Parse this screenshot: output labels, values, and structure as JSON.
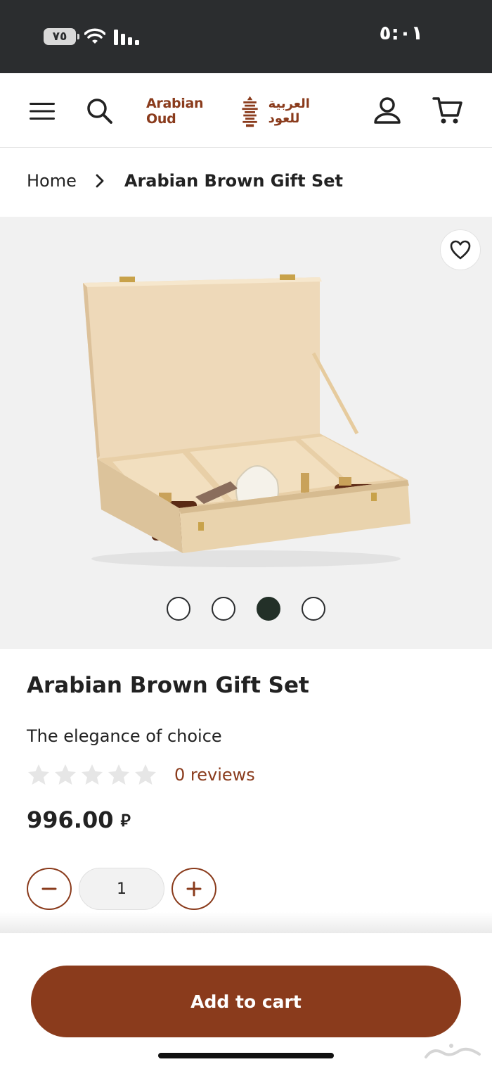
{
  "status_bar": {
    "battery": "٧٥",
    "time": "٥:٠١"
  },
  "header": {
    "logo_en": "Arabian Oud",
    "logo_ar": "العربية للعود",
    "icons": [
      "menu-icon",
      "search-icon",
      "logo-mark",
      "account-icon",
      "cart-icon"
    ]
  },
  "breadcrumb": {
    "home": "Home",
    "current": "Arabian Brown Gift Set"
  },
  "gallery": {
    "image_count": 4,
    "active_index": 2,
    "wishlist_icon": "heart-icon"
  },
  "product": {
    "title": "Arabian Brown Gift Set",
    "subtitle": "The elegance of choice",
    "rating": 0,
    "rating_max": 5,
    "reviews": "0 reviews",
    "price": "996.00",
    "currency": "⃁",
    "quantity": "1"
  },
  "actions": {
    "add_to_cart": "Add to cart"
  },
  "colors": {
    "brand": "#8a3b1c",
    "status_bar": "#2b2d2f",
    "active_dot": "#233028"
  }
}
